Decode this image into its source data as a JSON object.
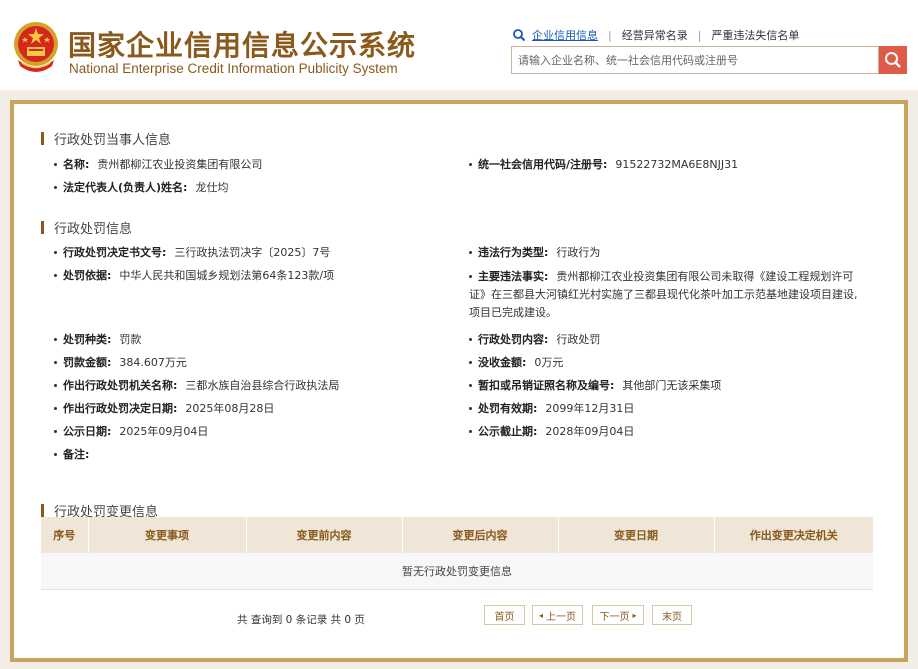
{
  "header": {
    "title_cn": "国家企业信用信息公示系统",
    "title_en": "National Enterprise Credit Information Publicity System",
    "nav": [
      "企业信用信息",
      "经营异常名录",
      "严重违法失信名单"
    ],
    "search_placeholder": "请输入企业名称、统一社会信用代码或注册号",
    "brand_color": "#8a5a1c",
    "search_button_color": "#e05a4a"
  },
  "party": {
    "title": "行政处罚当事人信息",
    "name_label": "名称:",
    "name_value": "贵州都柳江农业投资集团有限公司",
    "code_label": "统一社会信用代码/注册号:",
    "code_value": "91522732MA6E8NJJ31",
    "rep_label": "法定代表人(负责人)姓名:",
    "rep_value": "龙仕均"
  },
  "penalty": {
    "title": "行政处罚信息",
    "doc_label": "行政处罚决定书文号:",
    "doc_value": "三行政执法罚决字〔2025〕7号",
    "type_label": "违法行为类型:",
    "type_value": "行政行为",
    "basis_label": "处罚依据:",
    "basis_value": "中华人民共和国城乡规划法第64条123款/项",
    "fact_label": "主要违法事实:",
    "fact_value": "贵州都柳江农业投资集团有限公司未取得《建设工程规划许可证》在三都县大河镇红光村实施了三都县现代化茶叶加工示范基地建设项目建设,项目已完成建设。",
    "kind_label": "处罚种类:",
    "kind_value": "罚款",
    "content_label": "行政处罚内容:",
    "content_value": "行政处罚",
    "fine_label": "罚款金额:",
    "fine_value": "384.607万元",
    "confiscate_label": "没收金额:",
    "confiscate_value": "0万元",
    "authority_label": "作出行政处罚机关名称:",
    "authority_value": "三都水族自治县综合行政执法局",
    "license_label": "暂扣或吊销证照名称及编号:",
    "license_value": "其他部门无该采集项",
    "decision_date_label": "作出行政处罚决定日期:",
    "decision_date_value": "2025年08月28日",
    "valid_label": "处罚有效期:",
    "valid_value": "2099年12月31日",
    "pub_date_label": "公示日期:",
    "pub_date_value": "2025年09月04日",
    "pub_end_label": "公示截止期:",
    "pub_end_value": "2028年09月04日",
    "remark_label": "备注:"
  },
  "changes": {
    "title": "行政处罚变更信息",
    "columns": [
      "序号",
      "变更事项",
      "变更前内容",
      "变更后内容",
      "变更日期",
      "作出变更决定机关"
    ],
    "empty_text": "暂无行政处罚变更信息",
    "pager_info": "共 查询到 0 条记录 共 0 页",
    "first": "首页",
    "prev": "上一页",
    "next": "下一页",
    "last": "末页"
  }
}
